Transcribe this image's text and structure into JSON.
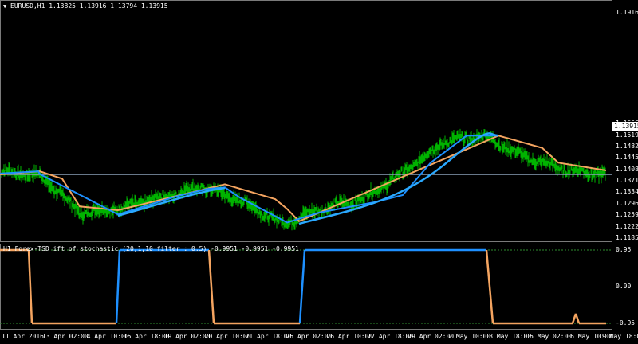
{
  "header": {
    "dropdown_glyph": "▼",
    "symbol": "EURUSD,H1",
    "ohlc": "1.13825 1.13916 1.13794 1.13915"
  },
  "indicator": {
    "caption": "H1 Forex-TSD ift of stochastic (20,1,10 filter : 0.5) -0.9951 -0.9951 -0.9951",
    "levels": [
      "0.95",
      "0.00",
      "-0.95"
    ]
  },
  "price_axis": {
    "labels": [
      "1.19166",
      "1.15564",
      "1.15194",
      "1.14824",
      "1.14454",
      "1.14084",
      "1.13714",
      "1.13344",
      "1.12964",
      "1.12594",
      "1.12224",
      "1.11854"
    ],
    "current_price": "1.13915"
  },
  "time_axis": {
    "labels": [
      "11 Apr 2016",
      "13 Apr 02:00",
      "14 Apr 10:00",
      "15 Apr 18:00",
      "19 Apr 02:00",
      "20 Apr 10:00",
      "21 Apr 18:00",
      "25 Apr 02:00",
      "26 Apr 10:00",
      "27 Apr 18:00",
      "29 Apr 02:00",
      "2 May 10:00",
      "3 May 18:00",
      "5 May 02:00",
      "6 May 10:00",
      "9 May 18:00"
    ]
  },
  "colors": {
    "background": "#000000",
    "candles": "#00b300",
    "step_line_orange": "#f4a460",
    "step_line_blue": "#1e90ff",
    "blue_curve": "#2aa8ff",
    "price_line": "#8aa0b8",
    "level_line": "#2e8b2e",
    "frame": "#7a7a7a"
  },
  "chart_data": {
    "type": "line",
    "x": [
      "11 Apr 2016",
      "13 Apr 02:00",
      "14 Apr 10:00",
      "15 Apr 18:00",
      "19 Apr 02:00",
      "20 Apr 10:00",
      "21 Apr 18:00",
      "25 Apr 02:00",
      "26 Apr 10:00",
      "27 Apr 18:00",
      "29 Apr 02:00",
      "2 May 10:00",
      "3 May 18:00",
      "5 May 02:00",
      "6 May 10:00",
      "9 May 18:00"
    ],
    "series": [
      {
        "values": [
          1.1402,
          1.1388,
          1.1268,
          1.1282,
          1.1318,
          1.1352,
          1.1305,
          1.1232,
          1.1282,
          1.1312,
          1.1398,
          1.1498,
          1.1518,
          1.1448,
          1.1408,
          1.1392
        ]
      },
      {
        "values": [
          0.95,
          0.95,
          -0.95,
          -0.95,
          -0.95,
          -0.95,
          -0.95,
          -0.95,
          0.95,
          0.95,
          0.95,
          0.95,
          -0.95,
          -0.95,
          -0.95,
          -0.95
        ]
      }
    ],
    "ylim": [
      1.11854,
      1.19166
    ]
  }
}
